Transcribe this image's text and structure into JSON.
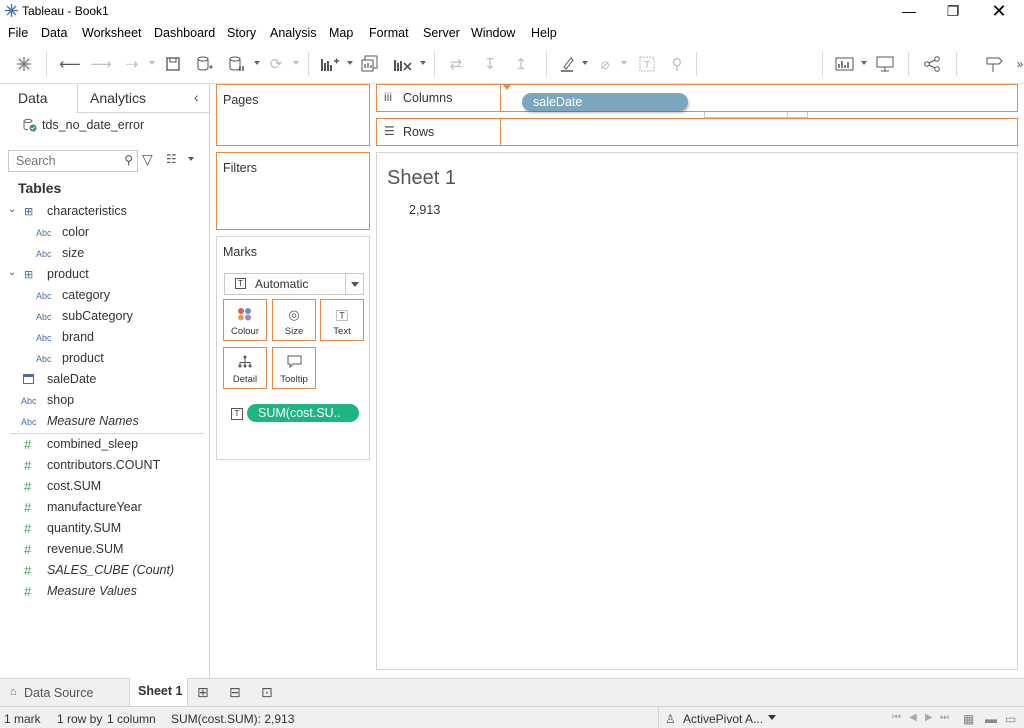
{
  "window": {
    "title": "Tableau - Book1"
  },
  "menu": [
    "File",
    "Data",
    "Worksheet",
    "Dashboard",
    "Story",
    "Analysis",
    "Map",
    "Format",
    "Server",
    "Window",
    "Help"
  ],
  "toolbar": {
    "fit_select": "Standard"
  },
  "left_pane": {
    "tabs": [
      "Data",
      "Analytics"
    ],
    "datasource": "tds_no_date_error",
    "search_placeholder": "Search",
    "tables_header": "Tables",
    "dimensions": [
      {
        "label": "characteristics",
        "kind": "table"
      },
      {
        "label": "color",
        "kind": "abc"
      },
      {
        "label": "size",
        "kind": "abc"
      },
      {
        "label": "product",
        "kind": "table"
      },
      {
        "label": "category",
        "kind": "abc"
      },
      {
        "label": "subCategory",
        "kind": "abc"
      },
      {
        "label": "brand",
        "kind": "abc"
      },
      {
        "label": "product",
        "kind": "abc"
      },
      {
        "label": "saleDate",
        "kind": "date"
      },
      {
        "label": "shop",
        "kind": "abc"
      },
      {
        "label": "Measure Names",
        "kind": "abc-italic"
      }
    ],
    "measures": [
      {
        "label": "combined_sleep",
        "italic": false
      },
      {
        "label": "contributors.COUNT",
        "italic": false
      },
      {
        "label": "cost.SUM",
        "italic": false
      },
      {
        "label": "manufactureYear",
        "italic": false
      },
      {
        "label": "quantity.SUM",
        "italic": false
      },
      {
        "label": "revenue.SUM",
        "italic": false
      },
      {
        "label": "SALES_CUBE (Count)",
        "italic": true
      },
      {
        "label": "Measure Values",
        "italic": true
      }
    ],
    "abc_glyph": "Abc"
  },
  "cards": {
    "pages": "Pages",
    "filters": "Filters",
    "marks": "Marks",
    "mark_type": "Automatic",
    "mark_buttons": [
      "Colour",
      "Size",
      "Text",
      "Detail",
      "Tooltip"
    ],
    "mark_pill": "SUM(cost.SU.."
  },
  "shelves": {
    "columns_label": "Columns",
    "rows_label": "Rows",
    "columns_pill": "saleDate"
  },
  "view": {
    "sheet_title": "Sheet 1",
    "value": "2,913"
  },
  "bottom_tabs": {
    "datasource": "Data Source",
    "sheet": "Sheet 1"
  },
  "status": {
    "marks": "1 mark",
    "rows": "1 row by",
    "cols": "1 column",
    "sum": "SUM(cost.SUM): 2,913",
    "user": "ActivePivot A..."
  },
  "colors": {
    "shelf_border": "#e28a4c",
    "dimension_pill": "#7aa7bd",
    "measure_pill": "#1fb582"
  }
}
